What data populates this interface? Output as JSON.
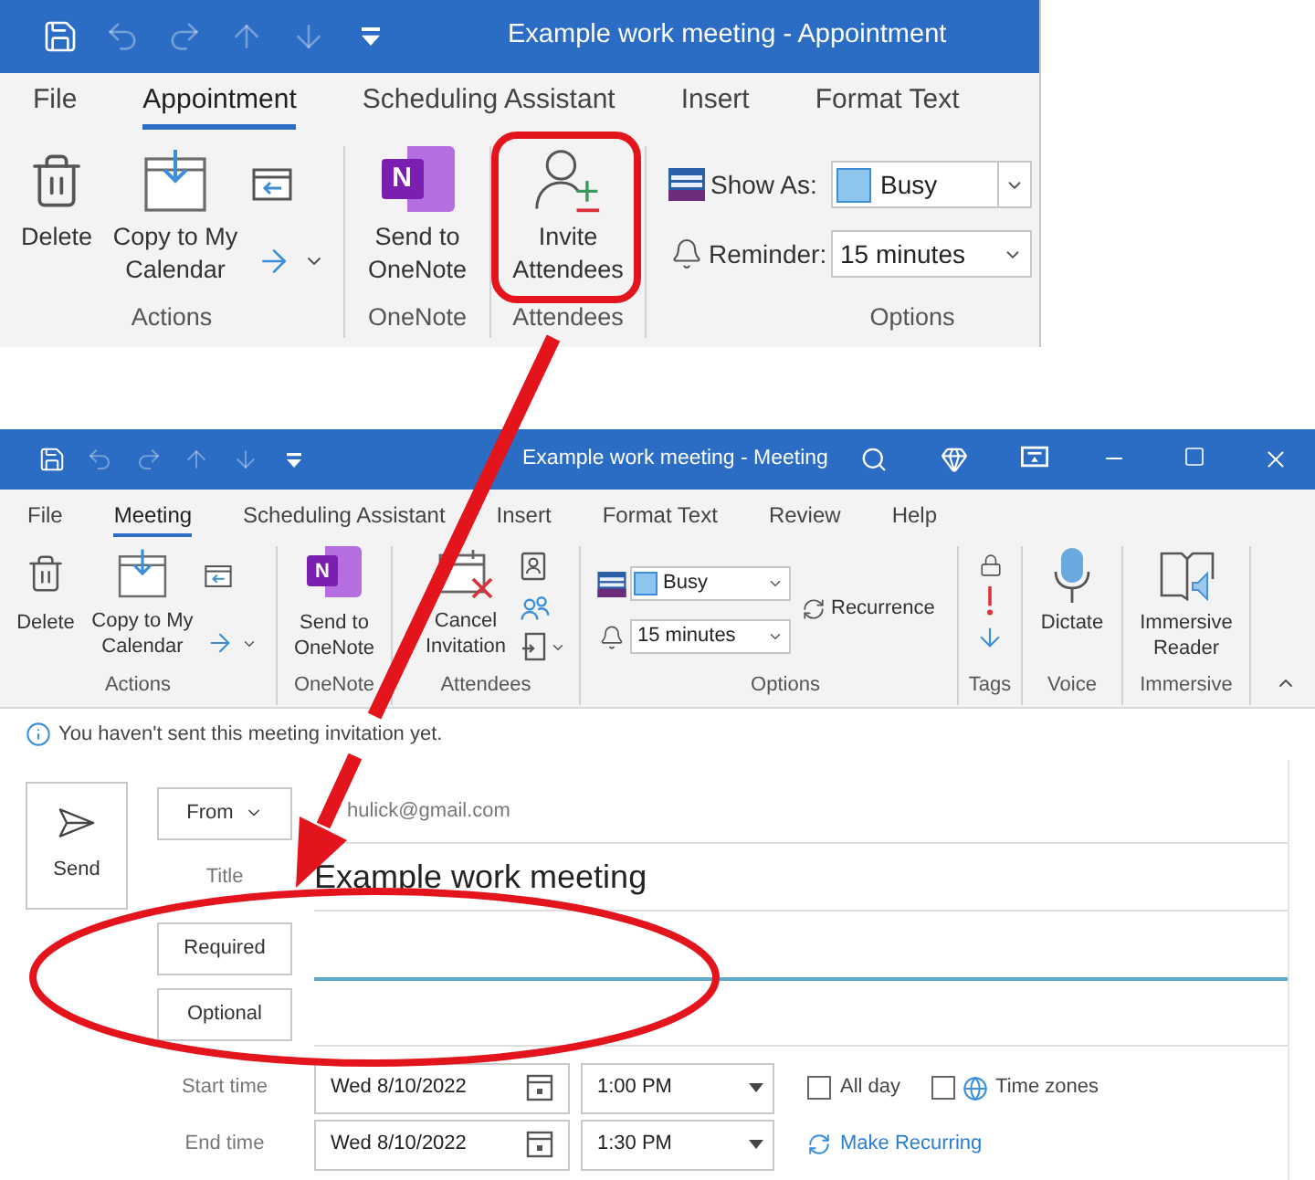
{
  "appointment_window": {
    "title": "Example work meeting - Appointment",
    "quick_access": [
      {
        "kind": "save",
        "disabled": false
      },
      {
        "kind": "undo",
        "disabled": true
      },
      {
        "kind": "redo",
        "disabled": true
      },
      {
        "kind": "previous",
        "disabled": true
      },
      {
        "kind": "next",
        "disabled": true
      },
      {
        "kind": "customize",
        "disabled": false
      }
    ],
    "tabs": [
      {
        "label": "File",
        "selected": false
      },
      {
        "label": "Appointment",
        "selected": true
      },
      {
        "label": "Scheduling Assistant",
        "selected": false
      },
      {
        "label": "Insert",
        "selected": false
      },
      {
        "label": "Format Text",
        "selected": false
      }
    ],
    "ribbon": {
      "actions": {
        "label": "Actions",
        "delete": "Delete",
        "copy_to_my_calendar": "Copy to My Calendar"
      },
      "onenote": {
        "label": "OneNote",
        "logo_letter": "N",
        "send_to_onenote": "Send to OneNote"
      },
      "attendees": {
        "label": "Attendees",
        "invite_attendees": "Invite Attendees"
      },
      "options": {
        "label": "Options",
        "show_as_label": "Show As:",
        "show_as_value": "Busy",
        "reminder_label": "Reminder:",
        "reminder_value": "15 minutes"
      }
    }
  },
  "meeting_window": {
    "title": "Example work meeting - Meeting",
    "quick_access": [
      {
        "kind": "save",
        "disabled": false
      },
      {
        "kind": "undo",
        "disabled": true
      },
      {
        "kind": "redo",
        "disabled": true
      },
      {
        "kind": "previous",
        "disabled": true
      },
      {
        "kind": "next",
        "disabled": true
      },
      {
        "kind": "customize",
        "disabled": false
      }
    ],
    "tabs": [
      {
        "label": "File",
        "selected": false
      },
      {
        "label": "Meeting",
        "selected": true
      },
      {
        "label": "Scheduling Assistant",
        "selected": false
      },
      {
        "label": "Insert",
        "selected": false
      },
      {
        "label": "Format Text",
        "selected": false
      },
      {
        "label": "Review",
        "selected": false
      },
      {
        "label": "Help",
        "selected": false
      }
    ],
    "ribbon": {
      "actions": {
        "label": "Actions",
        "delete": "Delete",
        "copy_to_my_calendar": "Copy to My Calendar"
      },
      "onenote": {
        "label": "OneNote",
        "logo_letter": "N",
        "send_to_onenote": "Send to OneNote"
      },
      "attendees": {
        "label": "Attendees",
        "cancel_invitation": "Cancel Invitation"
      },
      "options": {
        "label": "Options",
        "show_as_value": "Busy",
        "reminder_value": "15 minutes",
        "recurrence": "Recurrence"
      },
      "tags": {
        "label": "Tags"
      },
      "voice": {
        "label": "Voice",
        "dictate": "Dictate"
      },
      "immersive": {
        "label": "Immersive",
        "immersive_reader": "Immersive Reader"
      }
    },
    "info_bar": "You haven't sent this meeting invitation yet.",
    "form": {
      "send": "Send",
      "from_button": "From",
      "from_address": "hulick@gmail.com",
      "title_label": "Title",
      "title_value": "Example work meeting",
      "recipients": [
        {
          "button": "Required",
          "focused": true
        },
        {
          "button": "Optional",
          "focused": false
        }
      ],
      "start_label": "Start time",
      "start_date": "Wed 8/10/2022",
      "start_time": "1:00 PM",
      "all_day": {
        "label": "All day",
        "checked": false
      },
      "time_zones": {
        "label": "Time zones",
        "checked": false
      },
      "end_label": "End time",
      "end_date": "Wed 8/10/2022",
      "end_time": "1:30 PM",
      "make_recurring": "Make Recurring"
    }
  }
}
